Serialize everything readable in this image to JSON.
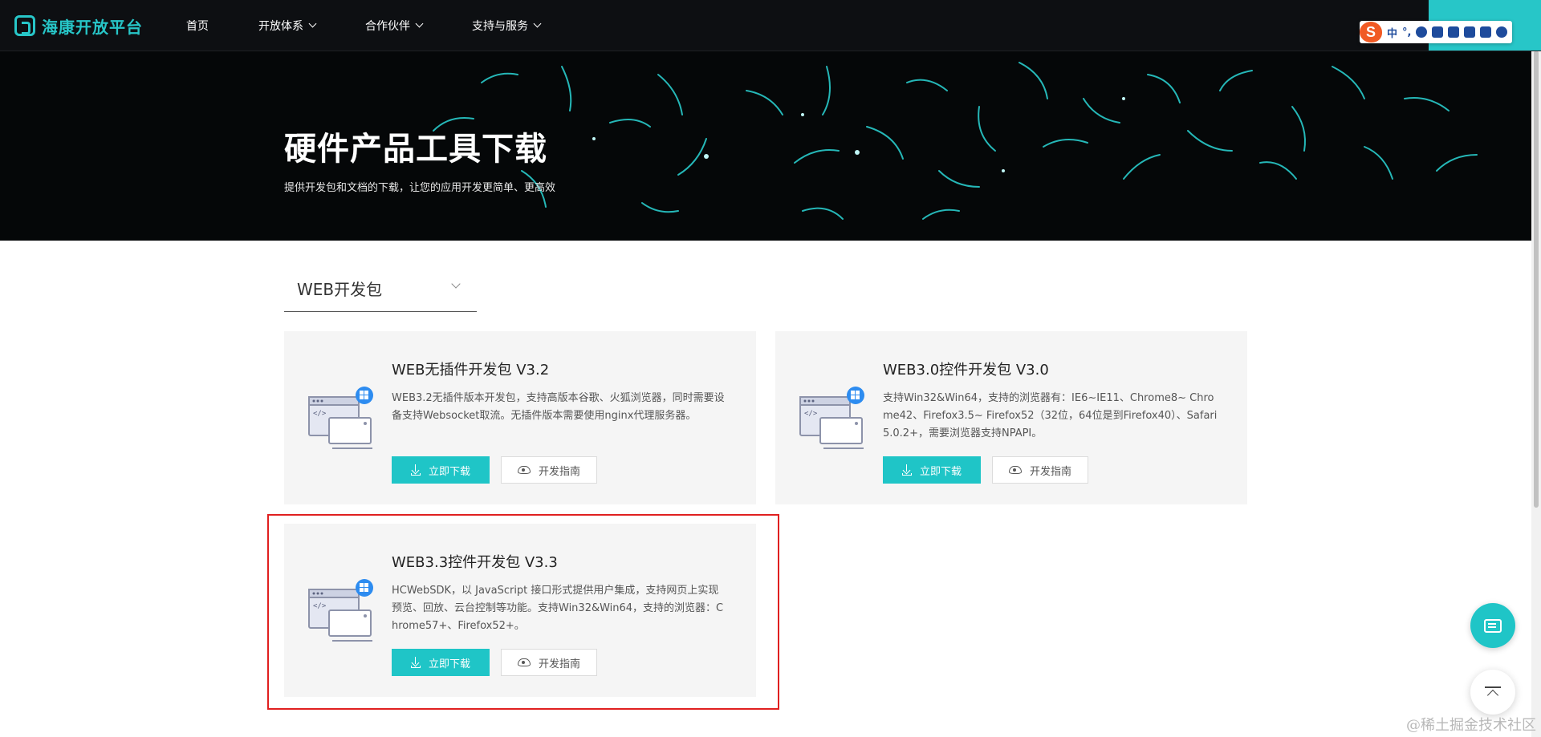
{
  "header": {
    "logo_text": "海康开放平台",
    "nav": [
      {
        "label": "首页",
        "has_dropdown": false
      },
      {
        "label": "开放体系",
        "has_dropdown": true
      },
      {
        "label": "合作伙伴",
        "has_dropdown": true
      },
      {
        "label": "支持与服务",
        "has_dropdown": true
      }
    ]
  },
  "ime_toolbar": {
    "logo": "S",
    "mode": "中",
    "punct": "°,",
    "icons": [
      "mic-icon",
      "keyboard-icon",
      "shirt-icon",
      "gamepad-icon",
      "grid-icon",
      "settings-icon"
    ]
  },
  "banner": {
    "title": "硬件产品工具下载",
    "subtitle": "提供开发包和文档的下载，让您的应用开发更简单、更高效"
  },
  "category_select": {
    "selected": "WEB开发包"
  },
  "cards": [
    {
      "title": "WEB无插件开发包 V3.2",
      "description": "WEB3.2无插件版本开发包，支持高版本谷歌、火狐浏览器，同时需要设备支持Websocket取流。无插件版本需要使用nginx代理服务器。",
      "download_label": "立即下载",
      "guide_label": "开发指南"
    },
    {
      "title": "WEB3.0控件开发包 V3.0",
      "description": "支持Win32&Win64，支持的浏览器有：IE6~IE11、Chrome8~ Chrome42、Firefox3.5~ Firefox52（32位，64位是到Firefox40）、Safari5.0.2+，需要浏览器支持NPAPI。",
      "download_label": "立即下载",
      "guide_label": "开发指南"
    },
    {
      "title": "WEB3.3控件开发包 V3.3",
      "description": "HCWebSDK，以 JavaScript 接口形式提供用户集成，支持网页上实现预览、回放、云台控制等功能。支持Win32&Win64，支持的浏览器：Chrome57+、Firefox52+。",
      "download_label": "立即下载",
      "guide_label": "开发指南"
    }
  ],
  "watermark": "@稀土掘金技术社区",
  "colors": {
    "accent": "#1fc5c7",
    "header_bg": "#0d0f12",
    "highlight": "#e02020"
  }
}
